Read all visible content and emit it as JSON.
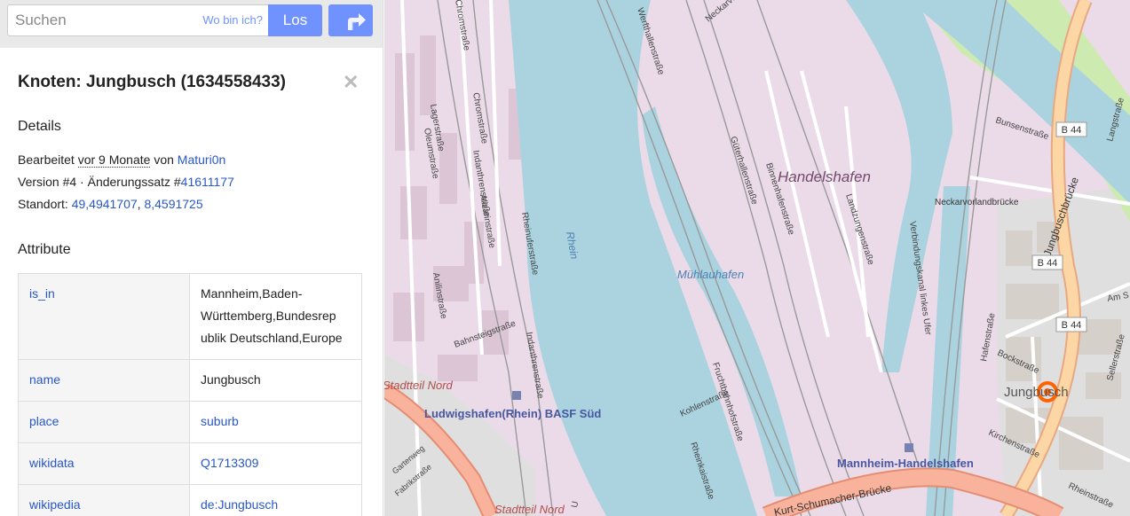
{
  "search": {
    "placeholder": "Suchen",
    "where_am_i": "Wo bin ich?",
    "go_label": "Los"
  },
  "node": {
    "title": "Knoten: Jungbusch (1634558433)",
    "details_heading": "Details",
    "edited_prefix": "Bearbeitet ",
    "edited_age": "vor 9 Monate",
    "edited_by": " von ",
    "user": "Maturi0n",
    "version_text": "Version #4 · Änderungssatz #",
    "changeset": "41611177",
    "location_label": "Standort: ",
    "lat": "49,4941707",
    "comma": ", ",
    "lon": "8,4591725",
    "attributes_heading": "Attribute"
  },
  "attributes": [
    {
      "key": "is_in",
      "value": "Mannheim,Baden-Württemberg,Bundesrepublik Deutschland,Europe",
      "lines": [
        "Mannheim,Baden-",
        "Württemberg,Bundesrep",
        "ublik Deutschland,Europe"
      ]
    },
    {
      "key": "name",
      "value": "Jungbusch"
    },
    {
      "key": "place",
      "value": "suburb"
    },
    {
      "key": "wikidata",
      "value": "Q1713309"
    },
    {
      "key": "wikipedia",
      "value": "de:Jungbusch"
    }
  ],
  "map": {
    "labels": {
      "handelshafen": "Handelshafen",
      "muhlauhafen": "Mühlauhafen",
      "rhein": "Rhein",
      "jungbusch": "Jungbusch",
      "bf_ludwigshafen": "Ludwigshafen(Rhein) BASF Süd",
      "bf_mannheim": "Mannheim-Handelshafen",
      "stadtteil_nord_1": "Stadtteil Nord",
      "stadtteil_nord_2": "Stadtteil Nord",
      "b44_1": "B 44",
      "b44_2": "B 44",
      "b44_3": "B 44",
      "neckarvorlandbruecke": "Neckarvorlandbrücke",
      "kurt_schumacher": "Kurt-Schumacher-Brücke",
      "jungbuschbruecke": "Jungbuschbrücke",
      "chromstrasse": "Chromstraße",
      "chromstrasse2": "Chromstraße",
      "lagerstrasse": "Lagerstraße",
      "oleumstrasse": "Oleumstraße",
      "indanthrenstrasse": "Indanthrenstraße",
      "indanthrenstrasse2": "Indanthrenstraße",
      "alizarinstrasse": "Alizarinstraße",
      "anilinstrasse": "Anilinstraße",
      "rheinuferstrasse": "Rheinuferstraße",
      "bahnstegstrasse": "Bahnsteigstraße",
      "wertheimstrasse": "Werfthallenstraße",
      "guterhallenstrasse": "Güterhallenstraße",
      "binnenhafenstrasse": "Binnenhafenstraße",
      "landzungenstrasse": "Landzungenstraße",
      "kohlenstrasse": "Kohlenstraße",
      "fruchtbahnhofstrasse": "Fruchtbahnhofstraße",
      "rheinkaistrasse": "Rheinkaistraße",
      "neckarvorlandstrasse": "Neckarvorlandstraße",
      "bunsenstrasse": "Bunsenstraße",
      "hafenstrasse": "Hafenstraße",
      "kirchenstrasse": "Kirchenstraße",
      "bockstrasse": "Bockstraße",
      "sellerstrasse": "Sellerstraße",
      "am_salz": "Am S",
      "langstrasse": "Langstraße",
      "rheinstrasse": "Rheinstraße",
      "verbindungskanal": "Verbindungskanal linkes Ufer",
      "gartenweg": "Gartenweg",
      "fabrikstrasse": "Fabrikstraße",
      "u_label": "U"
    },
    "colors": {
      "water": "#aad3df",
      "industrial": "#ebdbe8",
      "residential": "#e0dfdf",
      "major_road": "#fcd6a4",
      "primary_road": "#fcd6a4",
      "trunk": "#f9b29c",
      "rail": "#999999",
      "marker": "#ff6200",
      "accent": "#7092ff",
      "link": "#2857c9"
    }
  }
}
